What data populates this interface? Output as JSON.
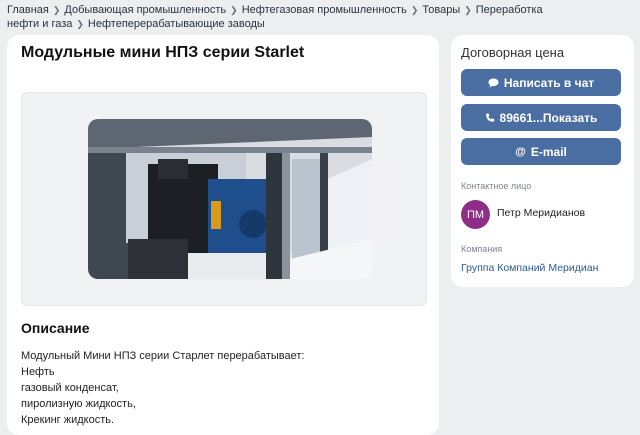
{
  "breadcrumbs": [
    "Главная",
    "Добывающая промышленность",
    "Нефтегазовая промышленность",
    "Товары",
    "Переработка нефти и газа",
    "Нефтеперерабатывающие заводы"
  ],
  "product": {
    "title": "Модульные мини НПЗ серии Starlet",
    "description_heading": "Описание",
    "description_lines": [
      "Модульный Мини НПЗ серии Старлет перерабатывает:",
      "Нефть",
      "газовый конденсат,",
      "пиролизную жидкость,",
      "Крекинг жидкость."
    ]
  },
  "sidebar": {
    "price": "Договорная цена",
    "chat_button": "Написать в чат",
    "phone_button": "89661...Показать",
    "email_button": "E-mail",
    "contact_label": "Контактное лицо",
    "contact_initials": "ПМ",
    "contact_name": "Петр Меридианов",
    "company_label": "Компания",
    "company_name": "Группа Компаний Меридиан"
  },
  "icons": {
    "chat": "chat-bubble-icon",
    "phone": "phone-icon",
    "email": "at-icon",
    "breadcrumb_separator": "chevron-right-icon"
  },
  "colors": {
    "button": "#4a6ea1",
    "avatar": "#8f2e88",
    "link": "#2d5a8e",
    "background": "#edeef0"
  }
}
